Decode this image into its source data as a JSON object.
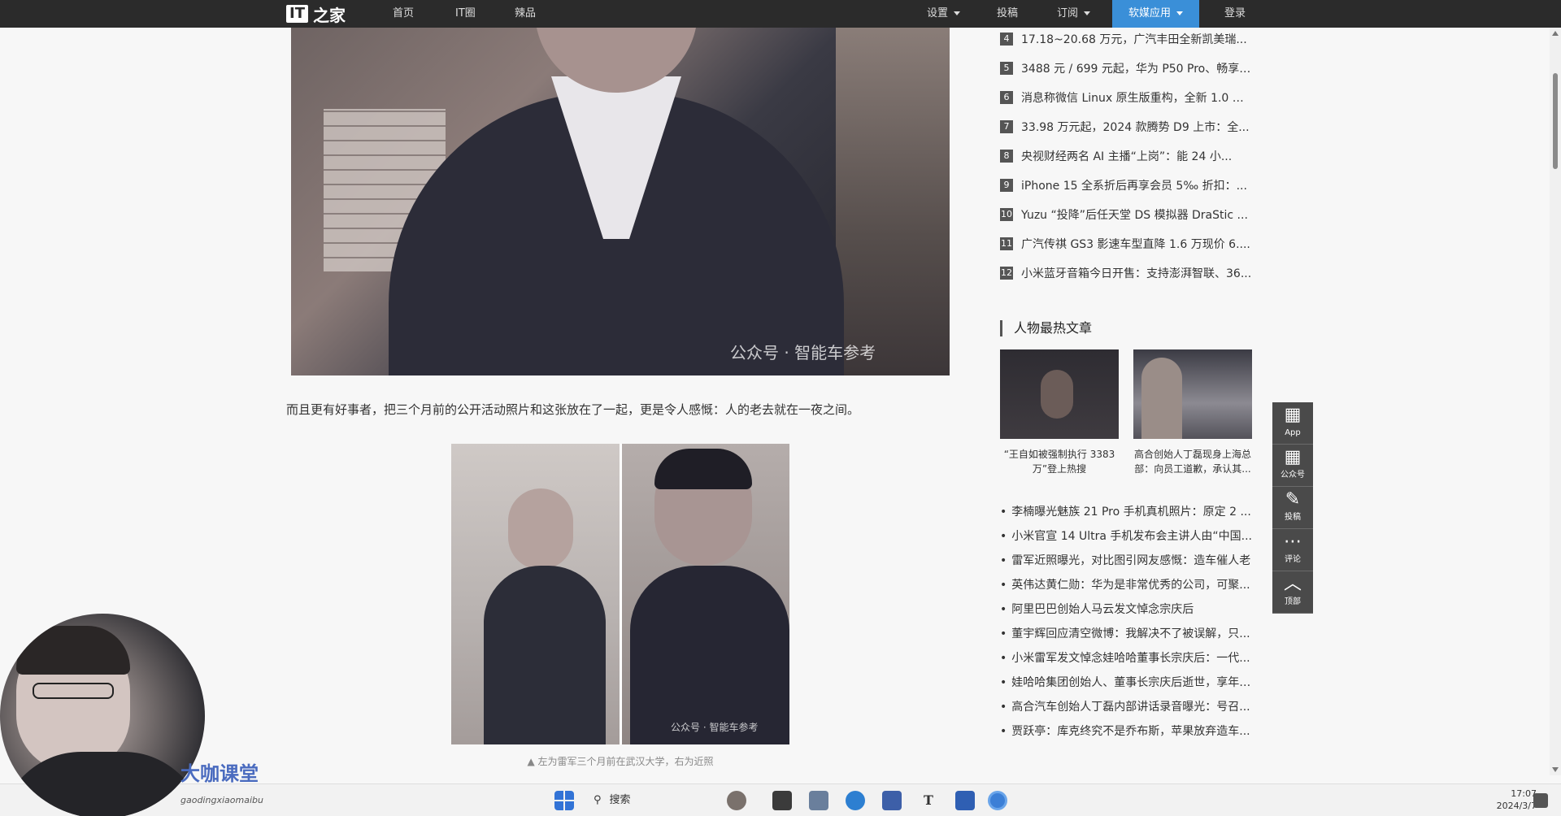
{
  "nav": {
    "logo_it": "IT",
    "logo_zh": "之家",
    "home": "首页",
    "itquan": "IT圈",
    "lapin": "辣品",
    "settings": "设置",
    "submit": "投稿",
    "subscribe": "订阅",
    "apps": "软媒应用",
    "login": "登录"
  },
  "article": {
    "watermark_1": "公众号 · 智能车参考",
    "paragraph": "而且更有好事者，把三个月前的公开活动照片和这张放在了一起，更是令人感慨：人的老去就在一夜之间。",
    "watermark_2": "公众号 · 智能车参考",
    "caption": "▲ 左为雷军三个月前在武汉大学，右为近照"
  },
  "rank_list": [
    {
      "num": "4",
      "title": "17.18~20.68 万元，广汽丰田全新凯美瑞..."
    },
    {
      "num": "5",
      "title": "3488 元 / 699 元起，华为 P50 Pro、畅享 ..."
    },
    {
      "num": "6",
      "title": "消息称微信 Linux 原生版重构，全新 1.0 版..."
    },
    {
      "num": "7",
      "title": "33.98 万元起，2024 款腾势 D9 上市：全..."
    },
    {
      "num": "8",
      "title": "央视财经两名 AI 主播“上岗”：能 24 小..."
    },
    {
      "num": "9",
      "title": "iPhone 15 全系折后再享会员 5‰ 折扣：..."
    },
    {
      "num": "10",
      "title": "Yuzu “投降”后任天堂 DS 模拟器 DraStic ..."
    },
    {
      "num": "11",
      "title": "广汽传祺 GS3 影速车型直降 1.6 万现价 6...."
    },
    {
      "num": "12",
      "title": "小米蓝牙音箱今日开售：支持澎湃智联、36..."
    }
  ],
  "people_section": {
    "title": "人物最热文章",
    "items": [
      {
        "caption": "“王自如被强制执行 3383 万”登上热搜"
      },
      {
        "caption": "高合创始人丁磊现身上海总部：向员工道歉，承认其..."
      }
    ]
  },
  "hot_list": [
    "李楠曝光魅族 21 Pro 手机真机照片：原定 2 ...",
    "小米官宣 14 Ultra 手机发布会主讲人由“中国...",
    "雷军近照曝光，对比图引网友感慨：造车催人老",
    "英伟达黄仁勋：华为是非常优秀的公司，可聚...",
    "阿里巴巴创始人马云发文悼念宗庆后",
    "董宇辉回应清空微博：我解决不了被误解，只...",
    "小米雷军发文悼念娃哈哈董事长宗庆后：一代...",
    "娃哈哈集团创始人、董事长宗庆后逝世，享年 ...",
    "高合汽车创始人丁磊内部讲话录音曝光：号召...",
    "贾跃亭：库克终究不是乔布斯，苹果放弃造车..."
  ],
  "float_bar": {
    "app": "App",
    "wechat": "公众号",
    "submit": "投稿",
    "comment": "评论",
    "top": "顶部"
  },
  "overlay": {
    "course_logo": "大咖课堂",
    "course_sub": "gaodingxiaomaibu"
  },
  "taskbar": {
    "search": "搜索",
    "time": "17:07",
    "date": "2024/3/7"
  },
  "colors": {
    "topbar": "#2b2b2b",
    "active_nav": "#3a8fd8"
  }
}
